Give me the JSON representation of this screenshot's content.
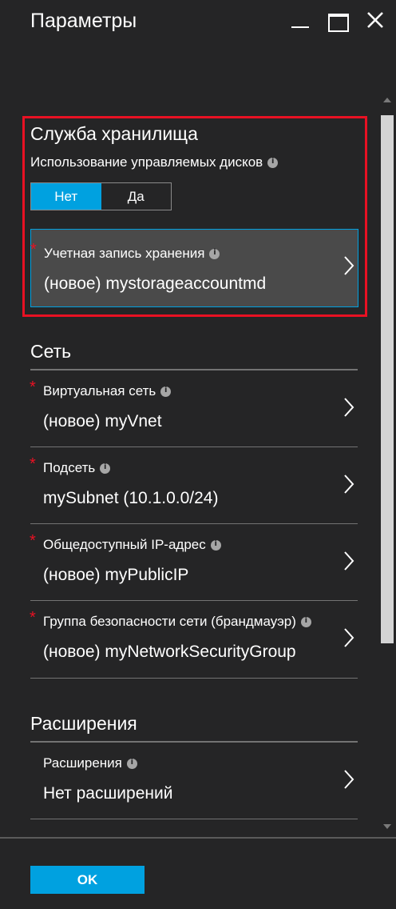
{
  "window": {
    "title": "Параметры"
  },
  "storage": {
    "section_title": "Служба хранилища",
    "managed_disks_label": "Использование управляемых дисков",
    "toggle": {
      "no_label": "Нет",
      "yes_label": "Да",
      "selected": "Нет"
    },
    "account": {
      "required_mark": "*",
      "label": "Учетная запись хранения",
      "value": "(новое) mystorageaccountmd"
    }
  },
  "network": {
    "section_title": "Сеть",
    "items": [
      {
        "required_mark": "*",
        "label": "Виртуальная сеть",
        "value": "(новое) myVnet"
      },
      {
        "required_mark": "*",
        "label": "Подсеть",
        "value": "mySubnet (10.1.0.0/24)"
      },
      {
        "required_mark": "*",
        "label": "Общедоступный IP-адрес",
        "value": "(новое) myPublicIP"
      },
      {
        "required_mark": "*",
        "label": "Группа безопасности сети (брандмауэр)",
        "value": "(новое) myNetworkSecurityGroup"
      }
    ]
  },
  "extensions": {
    "section_title": "Расширения",
    "items": [
      {
        "label": "Расширения",
        "value": "Нет расширений"
      }
    ]
  },
  "footer": {
    "ok_label": "OK"
  },
  "colors": {
    "accent": "#00a1e0",
    "highlight_border": "#e81123",
    "required": "#e81123",
    "background": "#252526"
  }
}
